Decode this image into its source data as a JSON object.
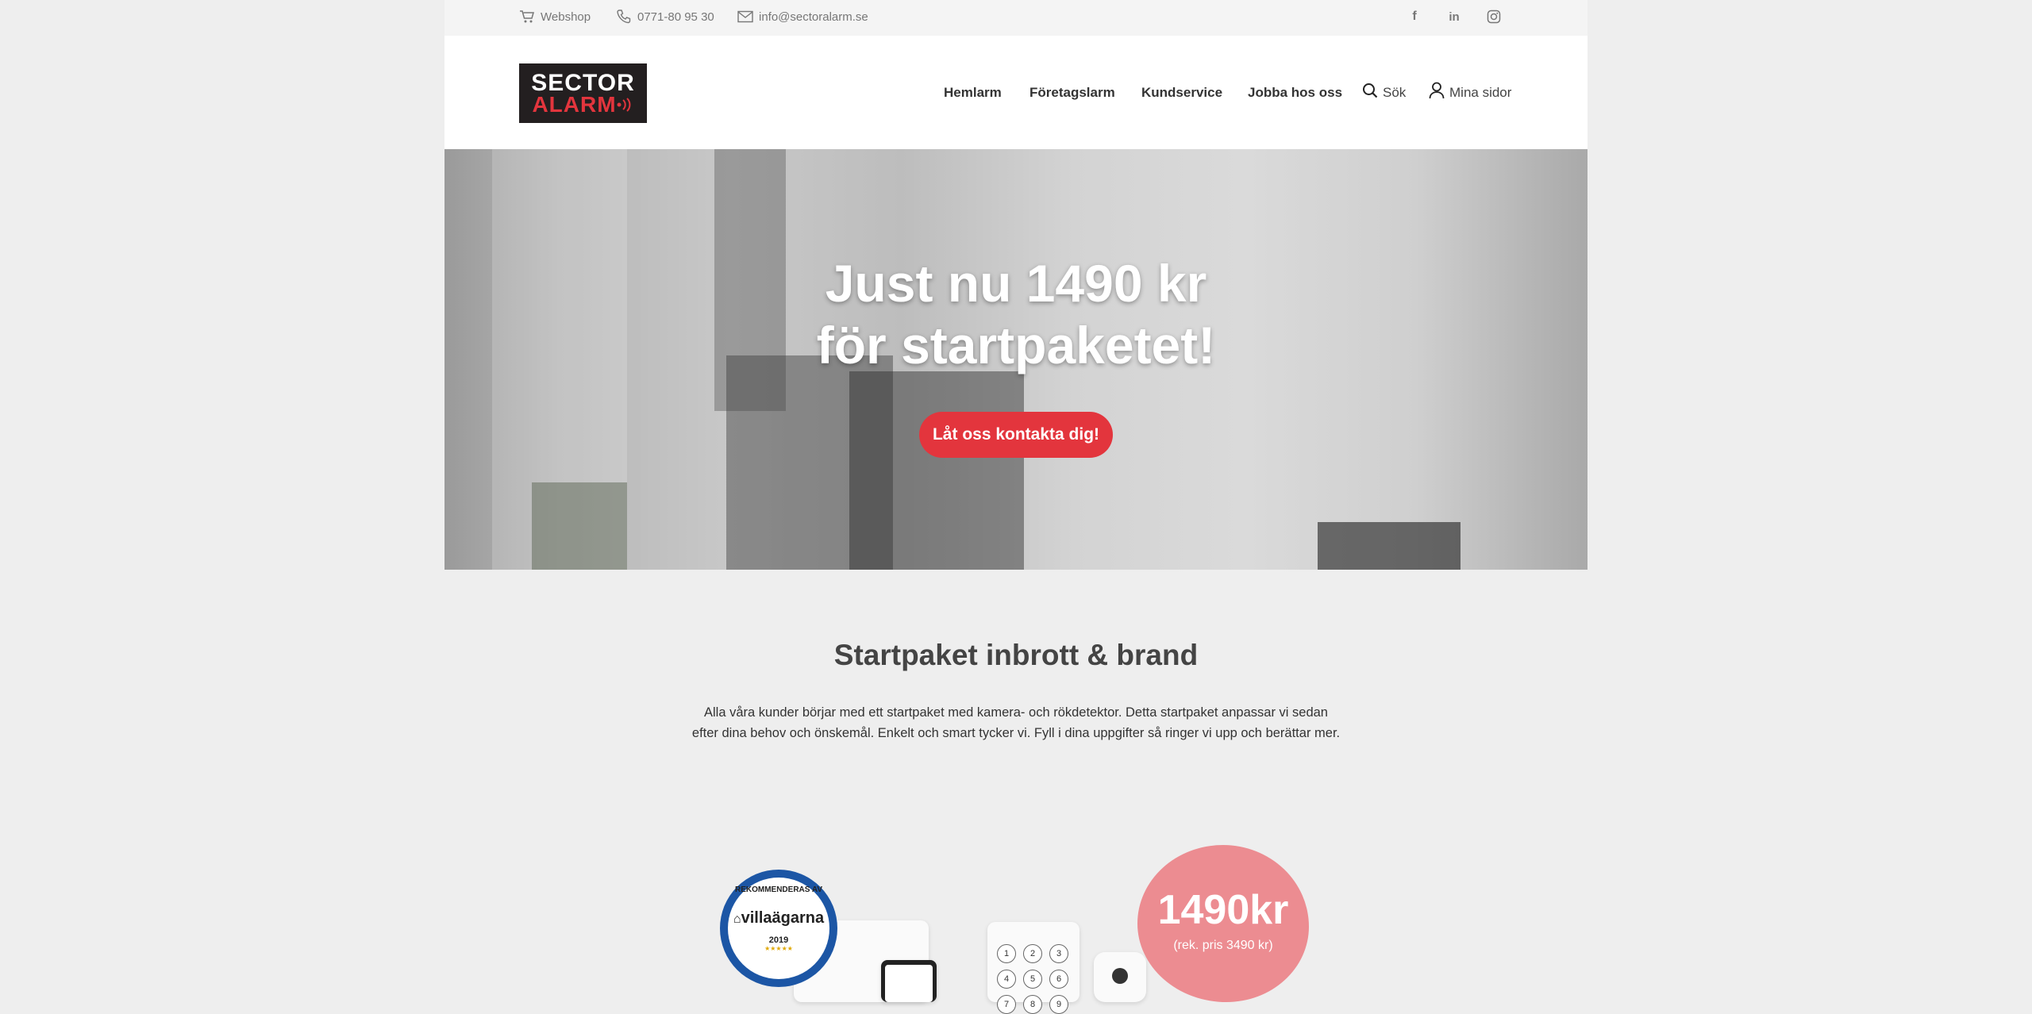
{
  "topbar": {
    "webshop": "Webshop",
    "phone": "0771-80 95 30",
    "email": "info@sectoralarm.se"
  },
  "logo": {
    "line1": "SECTOR",
    "line2": "ALARM"
  },
  "nav": {
    "items": [
      "Hemlarm",
      "Företagslarm",
      "Kundservice",
      "Jobba hos oss"
    ],
    "search": "Sök",
    "account": "Mina sidor"
  },
  "hero": {
    "title_line1": "Just nu 1490 kr",
    "title_line2": "för startpaketet!",
    "cta": "Låt oss kontakta dig!"
  },
  "section": {
    "heading": "Startpaket inbrott & brand",
    "intro_line1": "Alla våra kunder börjar med ett startpaket med kamera- och rökdetektor. Detta startpaket anpassar vi sedan",
    "intro_line2": "efter dina behov och önskemål. Enkelt och smart tycker vi. Fyll i dina uppgifter så ringer vi upp och berättar mer."
  },
  "badge": {
    "top": "REKOMMENDERAS AV",
    "brand": "villaägarna",
    "year": "2019"
  },
  "keypad": {
    "keys": [
      "1",
      "2",
      "3",
      "4",
      "5",
      "6",
      "7",
      "8",
      "9"
    ]
  },
  "price": {
    "amount": "1490",
    "currency": "kr",
    "note": "(rek. pris 3490 kr)"
  },
  "colors": {
    "accent": "#e3353d",
    "price_bubble": "#ec8c91",
    "badge_blue": "#1c56a5"
  }
}
